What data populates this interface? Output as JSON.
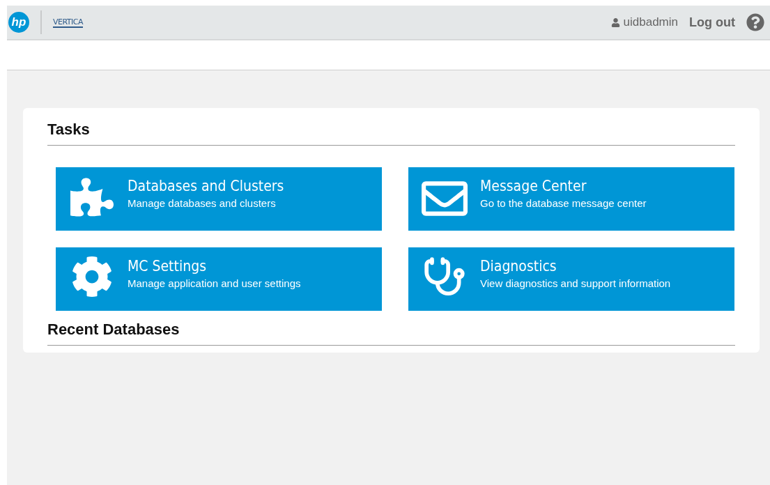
{
  "header": {
    "logos": [
      "hp",
      "VERTICA"
    ],
    "user": "uidbadmin",
    "logout": "Log out"
  },
  "tasks": {
    "title": "Tasks",
    "tiles": [
      {
        "kind": "puzzle",
        "title": "Databases and Clusters",
        "subtitle": "Manage databases and clusters"
      },
      {
        "kind": "mail",
        "title": "Message Center",
        "subtitle": "Go to the database message center"
      },
      {
        "kind": "gear",
        "title": "MC Settings",
        "subtitle": "Manage application and user settings"
      },
      {
        "kind": "stethoscope",
        "title": "Diagnostics",
        "subtitle": "View diagnostics and support information"
      }
    ]
  },
  "recent": {
    "title": "Recent Databases"
  }
}
